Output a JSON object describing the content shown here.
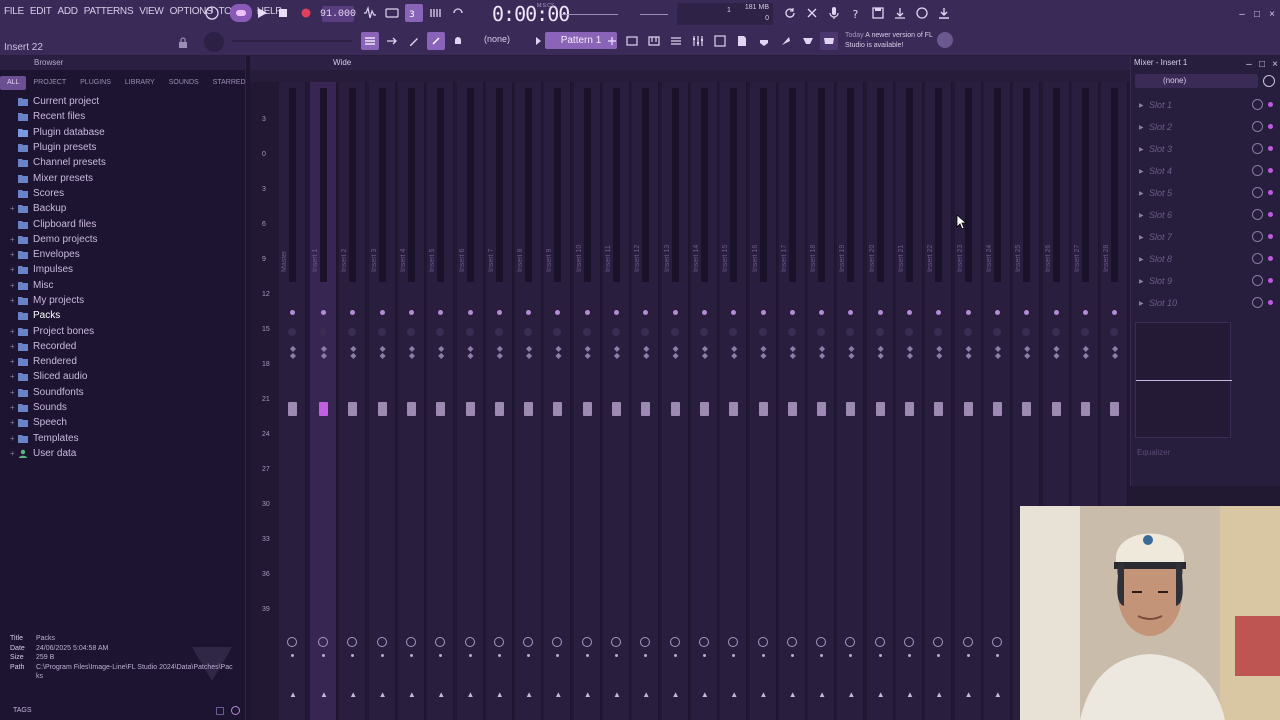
{
  "menu": [
    "FILE",
    "EDIT",
    "ADD",
    "PATTERNS",
    "VIEW",
    "OPTIONS",
    "TOOLS",
    "HELP"
  ],
  "hint_text": "Insert 22",
  "transport": {
    "tempo": "91.000",
    "time": "0:00:00",
    "time_label": "M:S:CS"
  },
  "cpu": {
    "memory": "181 MB",
    "voices": "1",
    "cpu": "0"
  },
  "pattern": {
    "snap": "(none)",
    "name": "Pattern 1"
  },
  "news": {
    "today": "Today",
    "message": "A newer version of FL Studio is available!"
  },
  "browser": {
    "title": "Browser",
    "tabs": [
      "ALL",
      "PROJECT",
      "PLUGINS",
      "LIBRARY",
      "SOUNDS",
      "STARRED"
    ],
    "active_tab": "ALL",
    "items": [
      {
        "label": "Current project",
        "exp": "",
        "icon": "folder"
      },
      {
        "label": "Recent files",
        "exp": "",
        "icon": "folder"
      },
      {
        "label": "Plugin database",
        "exp": "",
        "icon": "database"
      },
      {
        "label": "Plugin presets",
        "exp": "",
        "icon": "folder"
      },
      {
        "label": "Channel presets",
        "exp": "",
        "icon": "folder"
      },
      {
        "label": "Mixer presets",
        "exp": "",
        "icon": "folder"
      },
      {
        "label": "Scores",
        "exp": "",
        "icon": "folder"
      },
      {
        "label": "Backup",
        "exp": "+",
        "icon": "folder"
      },
      {
        "label": "Clipboard files",
        "exp": "",
        "icon": "folder"
      },
      {
        "label": "Demo projects",
        "exp": "+",
        "icon": "folder"
      },
      {
        "label": "Envelopes",
        "exp": "+",
        "icon": "folder"
      },
      {
        "label": "Impulses",
        "exp": "+",
        "icon": "folder"
      },
      {
        "label": "Misc",
        "exp": "+",
        "icon": "folder"
      },
      {
        "label": "My projects",
        "exp": "+",
        "icon": "folder"
      },
      {
        "label": "Packs",
        "exp": "",
        "icon": "folder",
        "active": true
      },
      {
        "label": "Project bones",
        "exp": "+",
        "icon": "folder"
      },
      {
        "label": "Recorded",
        "exp": "+",
        "icon": "folder"
      },
      {
        "label": "Rendered",
        "exp": "+",
        "icon": "folder"
      },
      {
        "label": "Sliced audio",
        "exp": "+",
        "icon": "folder"
      },
      {
        "label": "Soundfonts",
        "exp": "+",
        "icon": "folder"
      },
      {
        "label": "Sounds",
        "exp": "+",
        "icon": "folder"
      },
      {
        "label": "Speech",
        "exp": "+",
        "icon": "folder"
      },
      {
        "label": "Templates",
        "exp": "+",
        "icon": "folder"
      },
      {
        "label": "User data",
        "exp": "+",
        "icon": "user"
      }
    ],
    "info": {
      "title_key": "Title",
      "title": "Packs",
      "date_key": "Date",
      "date": "24/06/2025 5:04:58 AM",
      "size_key": "Size",
      "size": "259 B",
      "path_key": "Path",
      "path": "C:\\Program Files\\Image-Line\\FL Studio 2024\\Data\\Patches\\Packs"
    },
    "tags": "TAGS"
  },
  "mixer": {
    "title": "Wide",
    "db_scale": [
      "3",
      "0",
      "3",
      "6",
      "9",
      "12",
      "15",
      "18",
      "21",
      "24",
      "27",
      "30",
      "33",
      "36",
      "39"
    ],
    "tracks": [
      "Master",
      "Insert 1",
      "Insert 2",
      "Insert 3",
      "Insert 4",
      "Insert 5",
      "Insert 6",
      "Insert 7",
      "Insert 8",
      "Insert 9",
      "Insert 10",
      "Insert 11",
      "Insert 12",
      "Insert 13",
      "Insert 14",
      "Insert 15",
      "Insert 16",
      "Insert 17",
      "Insert 18",
      "Insert 19",
      "Insert 20",
      "Insert 21",
      "Insert 22",
      "Insert 23",
      "Insert 24",
      "Insert 25",
      "Insert 26",
      "Insert 27",
      "Insert 28"
    ],
    "selected_track": "Insert 1"
  },
  "mixer_insert": {
    "title": "Mixer - Insert 1",
    "preset": "(none)",
    "slots": [
      "Slot 1",
      "Slot 2",
      "Slot 3",
      "Slot 4",
      "Slot 5",
      "Slot 6",
      "Slot 7",
      "Slot 8",
      "Slot 9",
      "Slot 10"
    ],
    "eq_label": "Equalizer"
  },
  "colors": {
    "accent": "#c060e0",
    "topbar": "#3a2a58",
    "panel": "#221834"
  }
}
